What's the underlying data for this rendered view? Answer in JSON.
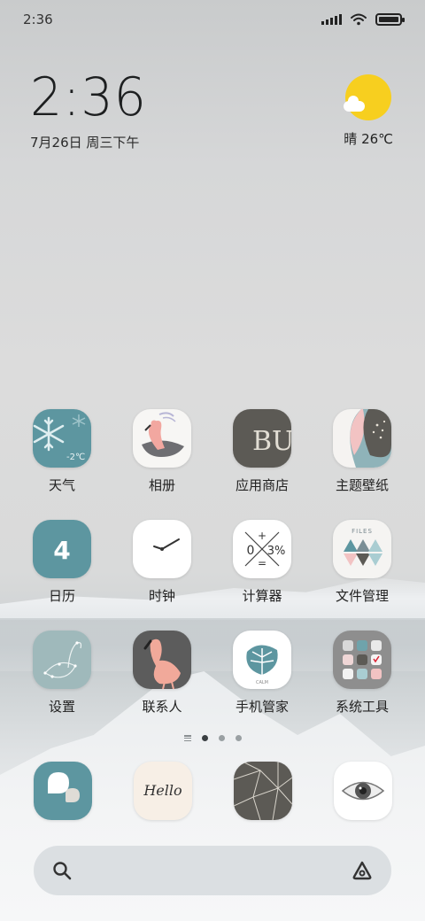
{
  "status_bar": {
    "time": "2:36"
  },
  "clock_widget": {
    "time": "2:36",
    "date": "7月26日 周三下午"
  },
  "weather_widget": {
    "text": "晴 26℃"
  },
  "apps": [
    {
      "label": "天气",
      "icon": "weather-icon"
    },
    {
      "label": "相册",
      "icon": "gallery-icon"
    },
    {
      "label": "应用商店",
      "icon": "app-store-icon"
    },
    {
      "label": "主题壁纸",
      "icon": "themes-icon"
    },
    {
      "label": "日历",
      "icon": "calendar-icon"
    },
    {
      "label": "时钟",
      "icon": "clock-icon"
    },
    {
      "label": "计算器",
      "icon": "calculator-icon"
    },
    {
      "label": "文件管理",
      "icon": "file-manager-icon"
    },
    {
      "label": "设置",
      "icon": "settings-icon"
    },
    {
      "label": "联系人",
      "icon": "contacts-icon"
    },
    {
      "label": "手机管家",
      "icon": "security-icon"
    },
    {
      "label": "系统工具",
      "icon": "system-tools-folder-icon"
    }
  ],
  "icon_texts": {
    "weather_temp": "-2℃",
    "app_store_letters": "BUY",
    "calendar_day": "4",
    "calc_zero": "0",
    "calc_plus": "+",
    "calc_percent": "3%",
    "calc_equals": "=",
    "files_title": "FILES",
    "security_caption": "CALM",
    "hello": "Hello"
  },
  "dock": [
    {
      "icon": "messages-icon"
    },
    {
      "icon": "notes-icon"
    },
    {
      "icon": "browser-icon"
    },
    {
      "icon": "camera-icon"
    }
  ],
  "pager": {
    "pages": 3,
    "current": 1
  },
  "search_bar": {
    "left_icon": "search-icon",
    "right_icon": "assistant-icon"
  },
  "colors": {
    "teal": "#5d96a0",
    "sun": "#f7cf1f",
    "dark_gray": "#5c5a55",
    "pink": "#f2c3c3"
  }
}
